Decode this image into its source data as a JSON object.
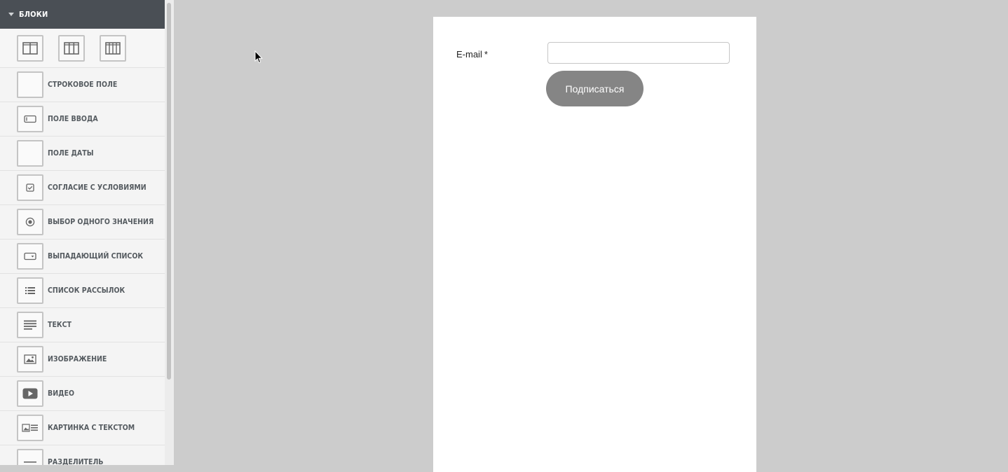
{
  "sidebar": {
    "header_title": "БЛОКИ",
    "layouts": [
      {
        "icon": "two-column-layout-icon"
      },
      {
        "icon": "three-column-layout-icon"
      },
      {
        "icon": "four-column-layout-icon"
      }
    ],
    "items": [
      {
        "label": "СТРОКОВОЕ ПОЛЕ",
        "icon": "blank-icon"
      },
      {
        "label": "ПОЛЕ ВВОДА",
        "icon": "input-field-icon"
      },
      {
        "label": "ПОЛЕ ДАТЫ",
        "icon": "blank-icon"
      },
      {
        "label": "СОГЛАСИЕ С УСЛОВИЯМИ",
        "icon": "checkbox-icon"
      },
      {
        "label": "ВЫБОР ОДНОГО ЗНАЧЕНИЯ",
        "icon": "radio-icon"
      },
      {
        "label": "ВЫПАДАЮЩИЙ СПИСОК",
        "icon": "dropdown-icon"
      },
      {
        "label": "СПИСОК РАССЫЛОК",
        "icon": "list-icon"
      },
      {
        "label": "ТЕКСТ",
        "icon": "text-lines-icon"
      },
      {
        "label": "ИЗОБРАЖЕНИЕ",
        "icon": "image-icon"
      },
      {
        "label": "ВИДЕО",
        "icon": "video-play-icon"
      },
      {
        "label": "КАРТИНКА С ТЕКСТОМ",
        "icon": "image-with-text-icon"
      },
      {
        "label": "РАЗДЕЛИТЕЛЬ",
        "icon": "divider-icon"
      }
    ]
  },
  "form": {
    "email_label": "E-mail",
    "required_mark": "*",
    "email_value": "",
    "submit_label": "Подписаться"
  },
  "colors": {
    "sidebar_header_bg": "#4a4f55",
    "canvas_bg": "#cccccc",
    "button_bg": "#858585",
    "icon_gray": "#c4c4c4"
  }
}
